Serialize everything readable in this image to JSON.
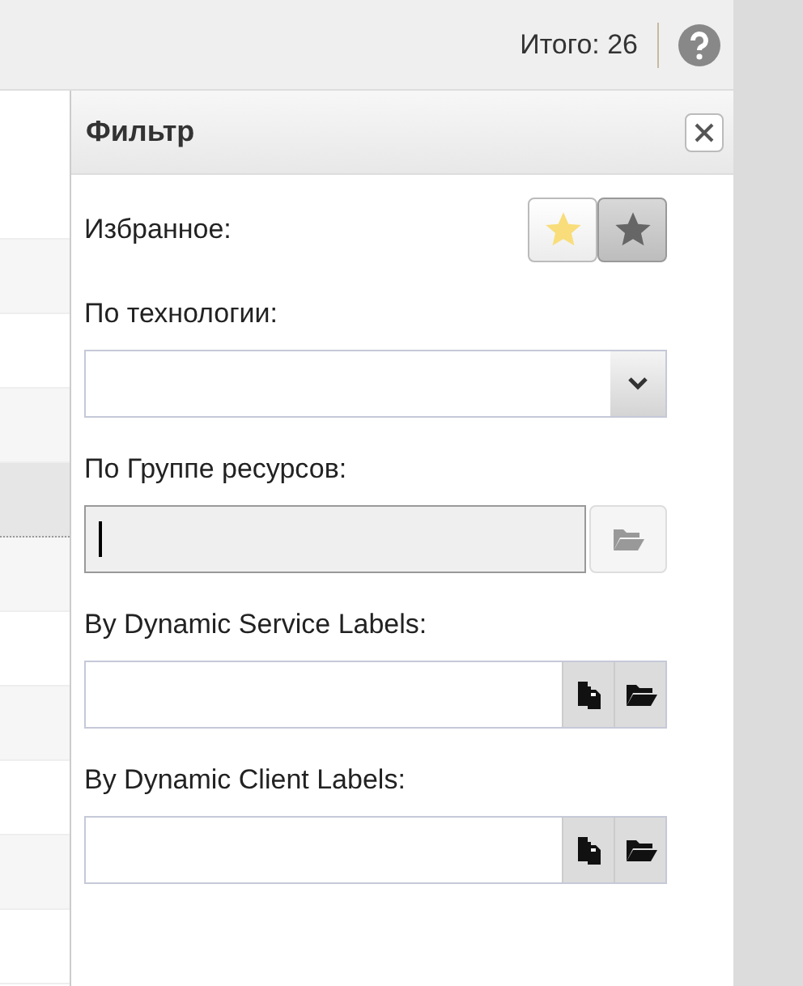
{
  "toolbar": {
    "total": "Итого: 26"
  },
  "table": {
    "rows": [
      {
        "selected": false
      },
      {
        "selected": false
      },
      {
        "selected": false
      },
      {
        "selected": false
      },
      {
        "selected": true
      },
      {
        "selected": false
      },
      {
        "selected": false
      },
      {
        "selected": false
      },
      {
        "selected": false
      },
      {
        "selected": false
      },
      {
        "selected": false
      }
    ]
  },
  "filter": {
    "title": "Фильтр",
    "favorites": {
      "label": "Избранное:",
      "buttons": [
        {
          "kind": "starred"
        },
        {
          "kind": "unstarred"
        }
      ]
    },
    "fields": [
      {
        "kind": "combo",
        "label": "По технологии:",
        "focused": false
      },
      {
        "kind": "group",
        "label": "По Группе ресурсов:",
        "focused": true
      },
      {
        "kind": "labels",
        "label": "By Dynamic Service Labels:",
        "focused": false
      },
      {
        "kind": "labels",
        "label": "By Dynamic Client Labels:",
        "focused": false
      }
    ]
  }
}
